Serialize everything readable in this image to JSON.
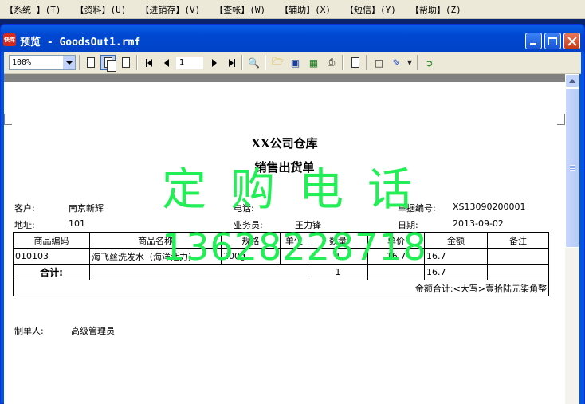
{
  "menu": [
    "【系统 】(T)",
    "【资料】(U)",
    "【进销存】(V)",
    "【查帐】(W)",
    "【辅助】(X)",
    "【短信】(Y)",
    "【帮助】(Z)"
  ],
  "window": {
    "icon_text": "快库",
    "title": "预览 - GoodsOut1.rmf"
  },
  "toolbar": {
    "zoom": "100%",
    "page_number": "1"
  },
  "report": {
    "company": "XX公司仓库",
    "title": "销售出货单",
    "customer_label": "客户:",
    "customer_value": "南京新辉",
    "phone_label": "电话:",
    "doc_no_label": "单据编号:",
    "doc_no_value": "XS13090200001",
    "address_label": "地址:",
    "address_value": "101",
    "salesman_label": "业务员:",
    "salesman_value": "王力锋",
    "date_label": "日期:",
    "date_value": "2013-09-02",
    "columns": [
      "商品编码",
      "商品名称",
      "规格",
      "单位",
      "数量",
      "单价",
      "金额",
      "备注"
    ],
    "rows": [
      [
        "010103",
        "海飞丝洗发水（海洋活力）",
        "200g",
        "",
        "1",
        "16.7",
        "16.7",
        ""
      ]
    ],
    "total_label": "合计:",
    "total_qty": "1",
    "total_amount": "16.7",
    "amount_in_words": "金额合计:<大写>壹拾陆元柒角整",
    "maker_label": "制单人:",
    "maker_value": "高级管理员"
  },
  "watermark": {
    "label": "定购电话",
    "number": "13628228718"
  }
}
